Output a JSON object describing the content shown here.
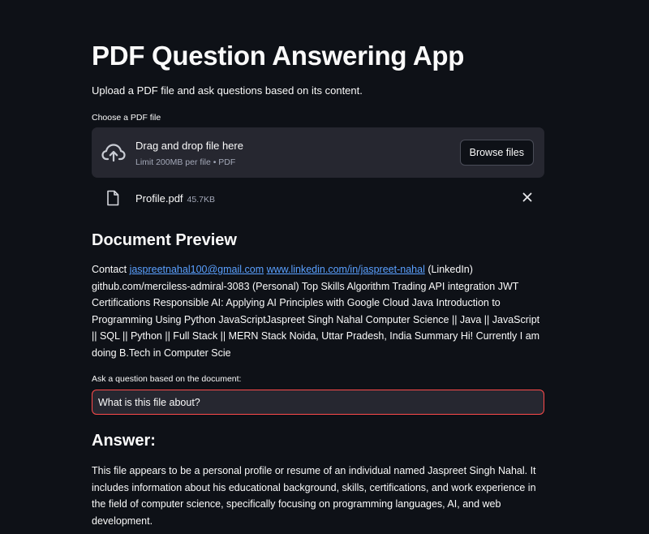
{
  "app": {
    "title": "PDF Question Answering App",
    "subtitle": "Upload a PDF file and ask questions based on its content."
  },
  "uploader": {
    "label": "Choose a PDF file",
    "drop_text": "Drag and drop file here",
    "limit_text": "Limit 200MB per file • PDF",
    "browse_label": "Browse files",
    "icons": [
      "cloud-upload-icon",
      "file-icon",
      "close-icon"
    ]
  },
  "file": {
    "name": "Profile.pdf",
    "size": "45.7KB"
  },
  "preview": {
    "heading": "Document Preview",
    "prefix": "Contact ",
    "email": "jaspreetnahal100@gmail.com",
    "linkedin": "www.linkedin.com/in/jaspreet-nahal",
    "body": " (LinkedIn) github.com/merciless-admiral-3083 (Personal) Top Skills Algorithm Trading API integration JWT Certifications Responsible AI: Applying AI Principles with Google Cloud Java Introduction to Programming Using Python JavaScriptJaspreet Singh Nahal Computer Science  || Java || JavaScript || SQL || Python || Full Stack || MERN Stack Noida, Uttar Pradesh, India Summary Hi! Currently I am doing B.Tech in Computer Scie"
  },
  "question": {
    "label": "Ask a question based on the document:",
    "value": "What is this file about?"
  },
  "answer": {
    "heading": "Answer:",
    "text": "This file appears to be a personal profile or resume of an individual named Jaspreet Singh Nahal. It includes information about his educational background, skills, certifications, and work experience in the field of computer science, specifically focusing on programming languages, AI, and web development."
  },
  "colors": {
    "background": "#0e1117",
    "surface": "#262730",
    "accent": "#ff4b4b",
    "link": "#5aa0ff",
    "muted": "#a3a8b8"
  }
}
